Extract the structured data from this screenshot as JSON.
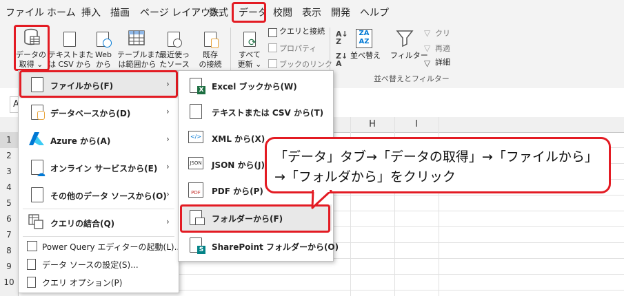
{
  "menubar": {
    "tabs": [
      "ファイル",
      "ホーム",
      "挿入",
      "描画",
      "ページ レイアウト",
      "数式",
      "データ",
      "校閲",
      "表示",
      "開発",
      "ヘルプ"
    ]
  },
  "ribbon": {
    "get_data": [
      "データの",
      "取得 ⌄"
    ],
    "text_csv": [
      "テキストまた",
      "は CSV から"
    ],
    "web": [
      "Web",
      "から"
    ],
    "table_range": [
      "テーブルまた",
      "は範囲から"
    ],
    "recent": [
      "最近使っ",
      "たソース"
    ],
    "existing": [
      "既存",
      "の接続"
    ],
    "refresh": [
      "すべて",
      "更新 ⌄"
    ],
    "queries_connections": "クエリと接続",
    "properties": "プロパティ",
    "edit_links": "ブックのリンク",
    "sort": "並べ替え",
    "filter": "フィルター",
    "clear": "クリ",
    "reapply": "再適",
    "advanced": "詳細",
    "group_sort_filter": "並べ替えとフィルター"
  },
  "sheet": {
    "name_box": "A",
    "columns": [
      "H",
      "I"
    ],
    "rows": [
      "1",
      "2",
      "3",
      "4",
      "5",
      "6",
      "7",
      "8",
      "9",
      "10"
    ]
  },
  "menu1": {
    "items": [
      {
        "label": "ファイルから(F)",
        "icon": "file-icon"
      },
      {
        "label": "データベースから(D)",
        "icon": "database-icon"
      },
      {
        "label": "Azure から(A)",
        "icon": "azure-icon"
      },
      {
        "label": "オンライン サービスから(E)",
        "icon": "cloud-icon"
      },
      {
        "label": "その他のデータ ソースから(O)",
        "icon": "other-sources-icon"
      },
      {
        "label": "クエリの結合(Q)",
        "icon": "combine-icon"
      }
    ],
    "extra": [
      {
        "label": "Power Query エディターの起動(L)...",
        "icon": "power-query-icon"
      },
      {
        "label": "データ ソースの設定(S)...",
        "icon": "data-source-settings-icon"
      },
      {
        "label": "クエリ オプション(P)",
        "icon": "query-options-icon"
      }
    ]
  },
  "menu2": {
    "items": [
      {
        "label": "Excel ブックから(W)",
        "icon": "excel-icon"
      },
      {
        "label": "テキストまたは CSV から(T)",
        "icon": "text-file-icon"
      },
      {
        "label": "XML から(X)",
        "icon": "xml-icon"
      },
      {
        "label": "JSON から(J)",
        "icon": "json-icon"
      },
      {
        "label": "PDF から(P)",
        "icon": "pdf-icon"
      },
      {
        "label": "フォルダーから(F)",
        "icon": "folder-icon"
      },
      {
        "label": "SharePoint フォルダーから(O)",
        "icon": "sharepoint-icon"
      }
    ]
  },
  "callout": {
    "line1": "「データ」タブ→「データの取得」→「ファイルから」",
    "line2": "→「フォルダから」をクリック"
  },
  "colors": {
    "highlight": "#e31b23",
    "excel_green": "#1d6f42",
    "azure_blue": "#0078d4"
  }
}
